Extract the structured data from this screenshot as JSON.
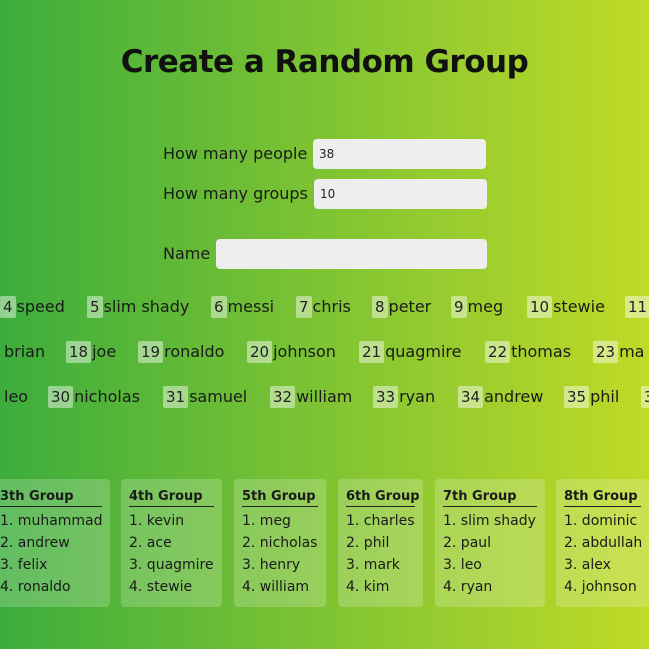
{
  "page": {
    "title": "Create a Random Group"
  },
  "form": {
    "people_label": "How many people",
    "people_value": "38",
    "groups_label": "How many groups",
    "groups_value": "10",
    "name_label": "Name",
    "name_value": ""
  },
  "roster_rows": [
    [
      {
        "num": "4",
        "name": "speed"
      },
      {
        "num": "5",
        "name": "slim shady"
      },
      {
        "num": "6",
        "name": "messi"
      },
      {
        "num": "7",
        "name": "chris"
      },
      {
        "num": "8",
        "name": "peter"
      },
      {
        "num": "9",
        "name": "meg"
      },
      {
        "num": "10",
        "name": "stewie"
      },
      {
        "num": "11",
        "name": ""
      }
    ],
    [
      {
        "num": "",
        "name": "brian"
      },
      {
        "num": "18",
        "name": "joe"
      },
      {
        "num": "19",
        "name": "ronaldo"
      },
      {
        "num": "20",
        "name": "johnson"
      },
      {
        "num": "21",
        "name": "quagmire"
      },
      {
        "num": "22",
        "name": "thomas"
      },
      {
        "num": "23",
        "name": "ma"
      }
    ],
    [
      {
        "num": "",
        "name": "leo"
      },
      {
        "num": "30",
        "name": "nicholas"
      },
      {
        "num": "31",
        "name": "samuel"
      },
      {
        "num": "32",
        "name": "william"
      },
      {
        "num": "33",
        "name": "ryan"
      },
      {
        "num": "34",
        "name": "andrew"
      },
      {
        "num": "35",
        "name": "phil"
      },
      {
        "num": "3",
        "name": ""
      }
    ]
  ],
  "groups": [
    {
      "title": "3th Group",
      "members": [
        "1. muhammad",
        "2. andrew",
        "3. felix",
        "4. ronaldo"
      ]
    },
    {
      "title": "4th Group",
      "members": [
        "1. kevin",
        "2. ace",
        "3. quagmire",
        "4. stewie"
      ]
    },
    {
      "title": "5th Group",
      "members": [
        "1. meg",
        "2. nicholas",
        "3. henry",
        "4. william"
      ]
    },
    {
      "title": "6th Group",
      "members": [
        "1. charles",
        "2. phil",
        "3. mark",
        "4. kim"
      ]
    },
    {
      "title": "7th Group",
      "members": [
        "1. slim shady",
        "2. paul",
        "3. leo",
        "4. ryan"
      ]
    },
    {
      "title": "8th Group",
      "members": [
        "1. dominic",
        "2. abdullah",
        "3. alex",
        "4. johnson"
      ]
    }
  ]
}
